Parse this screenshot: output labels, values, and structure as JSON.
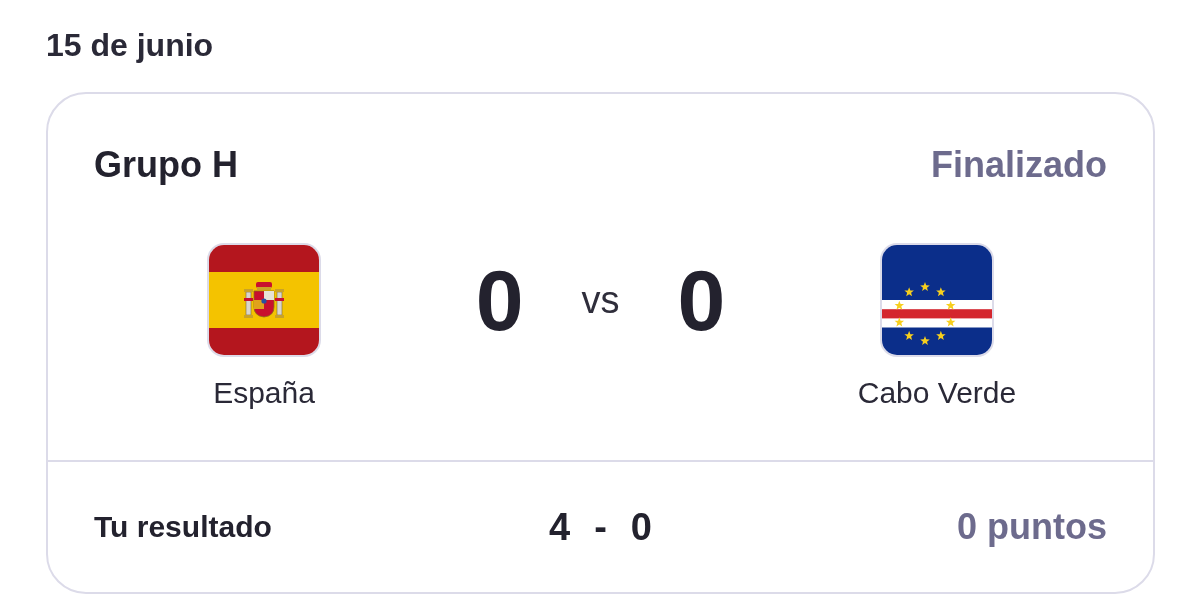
{
  "date": "15 de junio",
  "match": {
    "group": "Grupo H",
    "status": "Finalizado",
    "home": {
      "name": "España",
      "score": "0"
    },
    "separator": "vs",
    "away": {
      "name": "Cabo Verde",
      "score": "0"
    }
  },
  "prediction": {
    "label": "Tu resultado",
    "home_score": "4",
    "separator": "-",
    "away_score": "0",
    "points": "0 puntos"
  }
}
